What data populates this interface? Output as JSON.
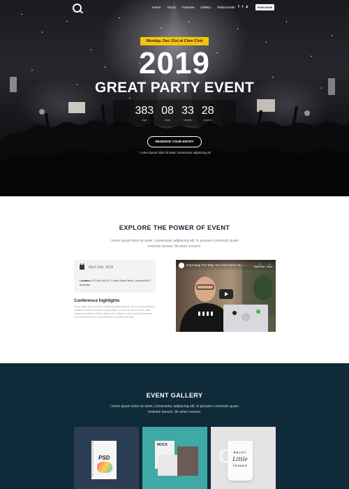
{
  "nav": {
    "links": [
      "Home",
      "About",
      "Features",
      "Gallery",
      "Testimonials"
    ],
    "social_icons": [
      "f",
      "t",
      "p"
    ],
    "purchase_label": "PURCHASE"
  },
  "hero": {
    "date_badge": "Monday, Dec 31st at Ckev Club",
    "year": "2019",
    "title": "GREAT PARTY EVENT",
    "countdown": [
      {
        "value": "383",
        "label": "days"
      },
      {
        "value": "08",
        "label": "hours"
      },
      {
        "value": "33",
        "label": "minutes"
      },
      {
        "value": "28",
        "label": "seconds"
      }
    ],
    "reserve_label": "RESERVE YOUR ENTRY",
    "note": "* Lorem ipsum dolor sit amet, consectetur adipiscing elit"
  },
  "explore": {
    "title": "EXPLORE THE POWER OF EVENT",
    "description": "Lorem ipsum dolor sit amet, consectetur adipiscing elit. In posuere commodo quam molestie laoreet. Sit amet consect.",
    "date": "April 10th, 2018",
    "location_label": "Location:",
    "location_value": "PO Box 16122, Collins Street West, Victoria 8007, Australia",
    "highlights_title": "Conference highlights",
    "highlights_text": "Lorem ipsum dolor sit amet, consectetur adipiscing elit, sed do eiusmod tempor incididunt ut labore et dolore magna aliqua. Ut enim ad minim veniam, quis nostrud exercitation ullamco laboris nisi ut aliquip ex ea commodo consequat. Duis aute irure dolor in reprehenderit in voluptate velit esse.",
    "video_title": "Improving The Way You Find Items On...",
    "video_watch_later": "Watch later",
    "video_share": "Share"
  },
  "gallery": {
    "title": "EVENT GALLERY",
    "description": "Lorem ipsum dolor sit amet, consectetur adipiscing elit. In posuere commodo quam molestie laoreet. Sit amet consect.",
    "tile1_text": "PSD",
    "tile2_text": "MOCK",
    "mug_line1": "ENJOY",
    "mug_line2": "Little",
    "mug_line3": "THINGS"
  }
}
